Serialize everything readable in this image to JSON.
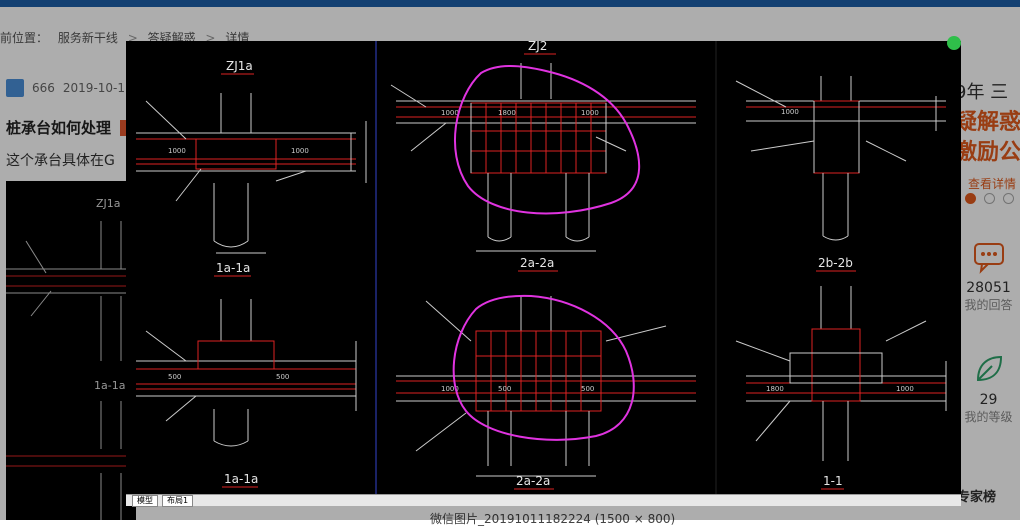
{
  "page": {
    "breadcrumb": [
      "前位置：",
      "服务新干线",
      ">",
      "答疑解惑",
      ">",
      "详情"
    ],
    "meta": {
      "user": "666",
      "date": "2019-10-1"
    },
    "question_title": "桩承台如何处理",
    "question_desc": "这个承台具体在G",
    "sidebar": {
      "year": "9年  三",
      "promo": [
        "疑解惑",
        "激励公"
      ],
      "promo_link": "查看详情",
      "stats": [
        {
          "value": "28051",
          "label": "我的回答"
        },
        {
          "value": "29",
          "label": "我的等级"
        }
      ],
      "expert_title": "专家榜"
    },
    "image_caption": "微信图片_20191011182224 (1500 × 800)"
  },
  "colors": {
    "accent": "#e25a1c",
    "header": "#1c5fa8",
    "markup": "#e033e0",
    "cad_bg": "#000000"
  },
  "drawing": {
    "labels": {
      "zj1a_top": "ZJ1a",
      "zj2_top": "ZJ2",
      "sec_1a1a_a": "1a-1a",
      "sec_1a1a_b": "1a-1a",
      "sec_2a2a_a": "2a-2a",
      "sec_2a2a_b": "2a-2a",
      "sec_2b2b": "2b-2b",
      "sec_11": "1-1",
      "bg_label": "ZJ1a",
      "bg_sec": "1a-1a"
    },
    "dims": [
      "1000",
      "1000",
      "500",
      "500",
      "1000",
      "1800",
      "1000",
      "1000",
      "500",
      "500",
      "1000",
      "1800",
      "1000"
    ],
    "tabs": [
      "模型",
      "布局1"
    ]
  }
}
